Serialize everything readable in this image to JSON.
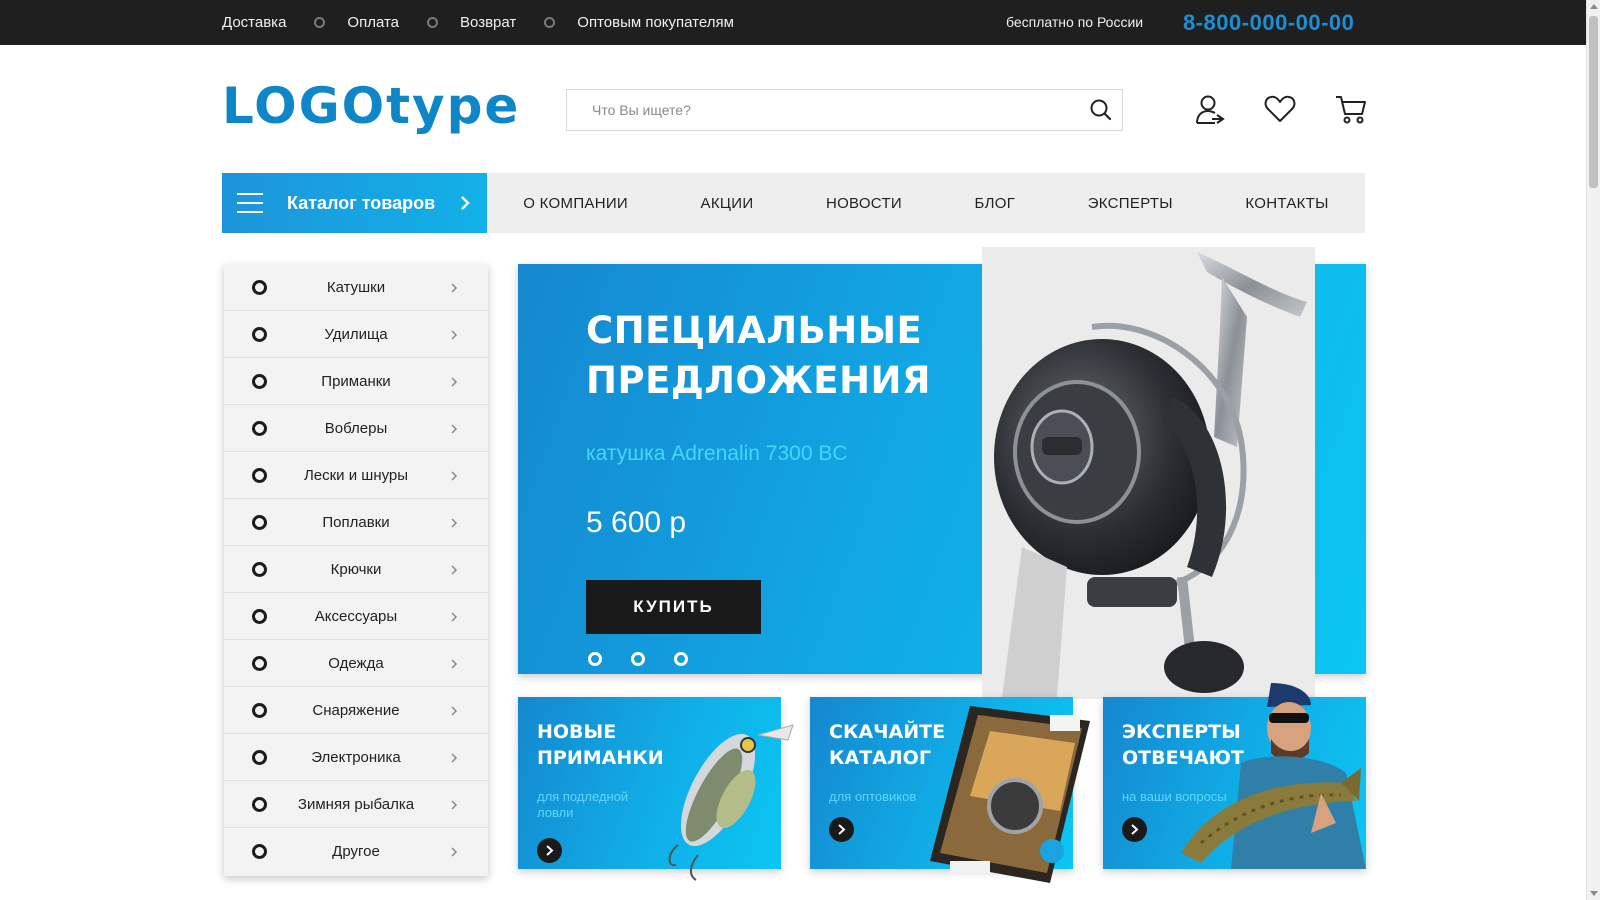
{
  "topbar": {
    "links": [
      "Доставка",
      "Оплата",
      "Возврат",
      "Оптовым покупателям"
    ],
    "free_text": "бесплатно по России",
    "phone": "8-800-000-00-00"
  },
  "header": {
    "logo": "LOGOtype",
    "search_placeholder": "Что Вы ищете?",
    "icons": [
      "user-icon",
      "heart-icon",
      "cart-icon"
    ]
  },
  "nav": {
    "catalog_label": "Каталог товаров",
    "links": [
      "О КОМПАНИИ",
      "АКЦИИ",
      "НОВОСТИ",
      "БЛОГ",
      "ЭКСПЕРТЫ",
      "КОНТАКТЫ"
    ]
  },
  "sidebar": {
    "items": [
      "Катушки",
      "Удилища",
      "Приманки",
      "Воблеры",
      "Лески и шнуры",
      "Поплавки",
      "Крючки",
      "Аксессуары",
      "Одежда",
      "Снаряжение",
      "Электроника",
      "Зимняя рыбалка",
      "Другое"
    ]
  },
  "hero": {
    "title": "СПЕЦИАЛЬНЫЕ ПРЕДЛОЖЕНИЯ",
    "subtitle": "катушка Adrenalin 7300 BC",
    "price": "5 600 р",
    "buy_label": "КУПИТЬ",
    "slide_count": 3
  },
  "promos": [
    {
      "title": "НОВЫЕ ПРИМАНКИ",
      "subtitle": "для подледной ловли"
    },
    {
      "title": "СКАЧАЙТЕ КАТАЛОГ",
      "subtitle": "для оптовиков"
    },
    {
      "title": "ЭКСПЕРТЫ ОТВЕЧАЮТ",
      "subtitle": "на ваши вопросы"
    }
  ],
  "colors": {
    "accent": "#1a8fd6",
    "topbar_bg": "#1f1f1f",
    "banner_start": "#1587cf",
    "banner_end": "#0bc6f2",
    "button_dark": "#1a1a1a"
  }
}
